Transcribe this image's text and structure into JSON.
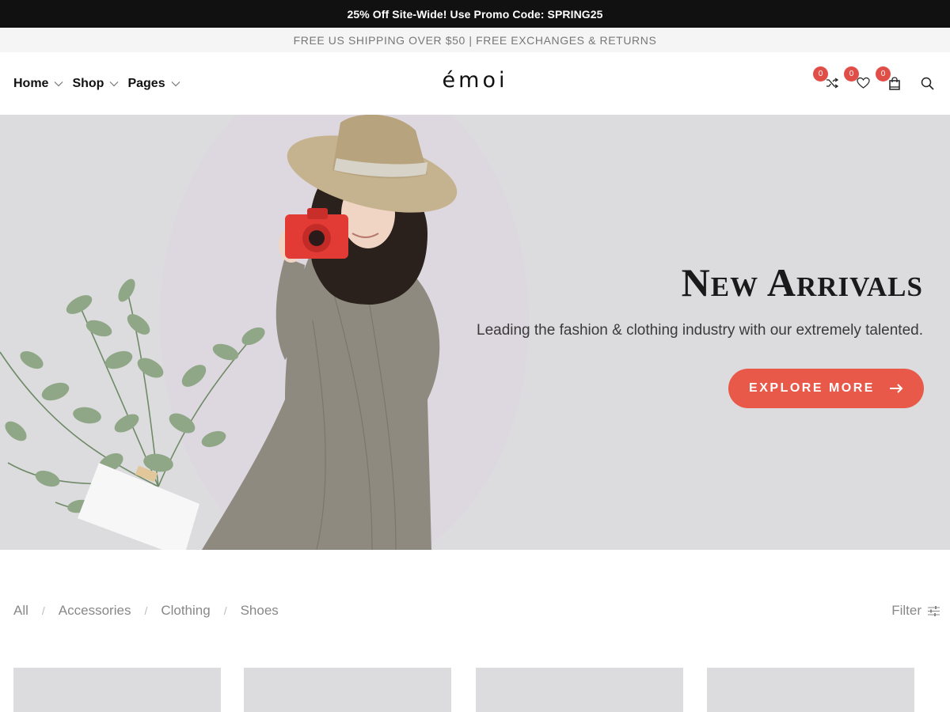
{
  "promo": {
    "text": "25% Off Site-Wide! Use Promo Code: SPRING25"
  },
  "shipping": {
    "text": "FREE US SHIPPING OVER $50 | FREE EXCHANGES & RETURNS"
  },
  "header": {
    "logo": "émoi",
    "nav": [
      {
        "label": "Home"
      },
      {
        "label": "Shop"
      },
      {
        "label": "Pages"
      }
    ],
    "icons": {
      "compare_count": "0",
      "wishlist_count": "0",
      "cart_count": "0"
    }
  },
  "hero": {
    "title": "New Arrivals",
    "subtitle": "Leading the fashion & clothing industry with our extremely talented.",
    "button_label": "EXPLORE MORE",
    "colors": {
      "accent": "#e8594a",
      "background": "#dcdcdf",
      "circle": "#ddd7df"
    }
  },
  "filters": {
    "categories": [
      "All",
      "Accessories",
      "Clothing",
      "Shoes"
    ],
    "filter_label": "Filter"
  },
  "colors": {
    "badge": "#e04e47",
    "promo_bg": "#111111"
  }
}
